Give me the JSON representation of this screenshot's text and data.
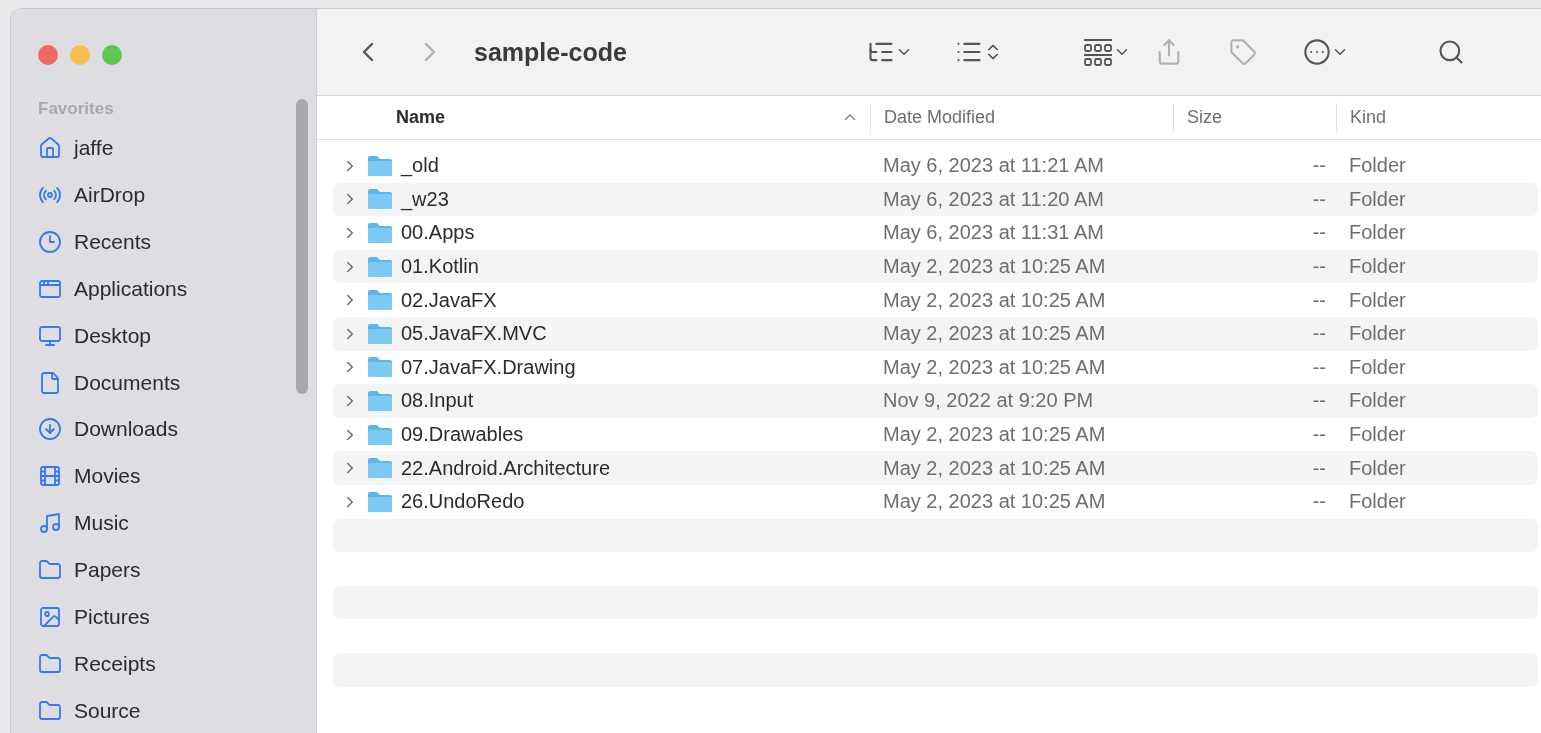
{
  "window": {
    "title": "sample-code"
  },
  "toolbar": {
    "buttons": [
      {
        "kind": "back",
        "disabled": false
      },
      {
        "kind": "forward",
        "disabled": true
      },
      {
        "kind": "group",
        "disabled": false
      },
      {
        "kind": "sort",
        "disabled": false
      },
      {
        "kind": "view",
        "disabled": false
      },
      {
        "kind": "share",
        "disabled": true
      },
      {
        "kind": "tag",
        "disabled": true
      },
      {
        "kind": "more",
        "disabled": false
      },
      {
        "kind": "search",
        "disabled": false
      }
    ]
  },
  "sidebar": {
    "section": "Favorites",
    "items": [
      {
        "label": "jaffe",
        "kind": "home"
      },
      {
        "label": "AirDrop",
        "kind": "airdrop"
      },
      {
        "label": "Recents",
        "kind": "recents"
      },
      {
        "label": "Applications",
        "kind": "applications"
      },
      {
        "label": "Desktop",
        "kind": "desktop"
      },
      {
        "label": "Documents",
        "kind": "document"
      },
      {
        "label": "Downloads",
        "kind": "downloads"
      },
      {
        "label": "Movies",
        "kind": "movies"
      },
      {
        "label": "Music",
        "kind": "music"
      },
      {
        "label": "Papers",
        "kind": "folder"
      },
      {
        "label": "Pictures",
        "kind": "pictures"
      },
      {
        "label": "Receipts",
        "kind": "folder"
      },
      {
        "label": "Source",
        "kind": "folder"
      }
    ]
  },
  "table": {
    "columns": [
      {
        "label": "Name",
        "sorted": true
      },
      {
        "label": "Date Modified",
        "sorted": false
      },
      {
        "label": "Size",
        "sorted": false
      },
      {
        "label": "Kind",
        "sorted": false
      }
    ],
    "rows": [
      {
        "name": "_old",
        "date": "May 6, 2023 at 11:21 AM",
        "size": "--",
        "kind": "Folder",
        "expanded": false
      },
      {
        "name": "_w23",
        "date": "May 6, 2023 at 11:20 AM",
        "size": "--",
        "kind": "Folder",
        "expanded": false
      },
      {
        "name": "00.Apps",
        "date": "May 6, 2023 at 11:31 AM",
        "size": "--",
        "kind": "Folder",
        "expanded": false
      },
      {
        "name": "01.Kotlin",
        "date": "May 2, 2023 at 10:25 AM",
        "size": "--",
        "kind": "Folder",
        "expanded": false
      },
      {
        "name": "02.JavaFX",
        "date": "May 2, 2023 at 10:25 AM",
        "size": "--",
        "kind": "Folder",
        "expanded": false
      },
      {
        "name": "05.JavaFX.MVC",
        "date": "May 2, 2023 at 10:25 AM",
        "size": "--",
        "kind": "Folder",
        "expanded": false
      },
      {
        "name": "07.JavaFX.Drawing",
        "date": "May 2, 2023 at 10:25 AM",
        "size": "--",
        "kind": "Folder",
        "expanded": false
      },
      {
        "name": "08.Input",
        "date": "Nov 9, 2022 at 9:20 PM",
        "size": "--",
        "kind": "Folder",
        "expanded": false
      },
      {
        "name": "09.Drawables",
        "date": "May 2, 2023 at 10:25 AM",
        "size": "--",
        "kind": "Folder",
        "expanded": false
      },
      {
        "name": "22.Android.Architecture",
        "date": "May 2, 2023 at 10:25 AM",
        "size": "--",
        "kind": "Folder",
        "expanded": false
      },
      {
        "name": "26.UndoRedo",
        "date": "May 2, 2023 at 10:25 AM",
        "size": "--",
        "kind": "Folder",
        "expanded": false
      }
    ]
  }
}
